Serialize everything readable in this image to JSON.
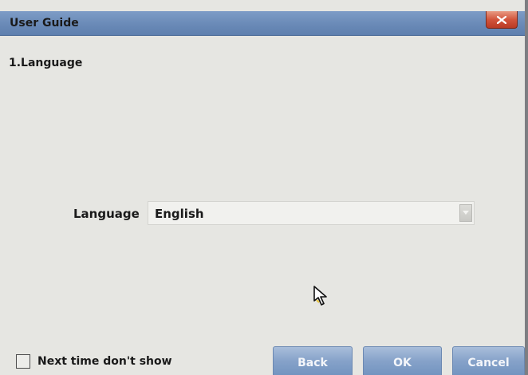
{
  "window": {
    "title": "User Guide",
    "close_glyph": "X"
  },
  "step": {
    "title": "1.Language"
  },
  "language": {
    "label": "Language",
    "selected": "English"
  },
  "footer": {
    "checkbox_label": "Next time don't show",
    "checkbox_checked": false,
    "back_label": "Back",
    "ok_label": "OK",
    "cancel_label": "Cancel"
  },
  "icons": {
    "close": "close-icon",
    "dropdown": "chevron-down-icon",
    "cursor": "mouse-cursor-icon"
  },
  "colors": {
    "titlebar": "#6a8ab7",
    "dialog_bg": "#e6e6e2",
    "button": "#86a2c9",
    "close_button": "#d2553c"
  }
}
